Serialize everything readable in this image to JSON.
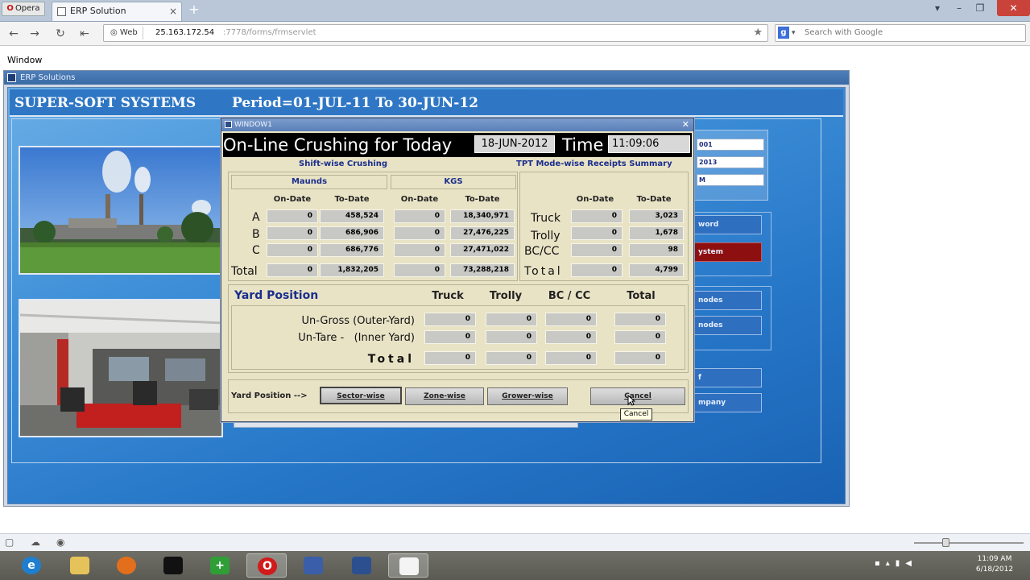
{
  "browser": {
    "menu_label": "Opera",
    "tab_title": "ERP Solution",
    "web_chip": "Web",
    "url_host": "25.163.172.54",
    "url_path": ":7778/forms/frmservlet",
    "search_placeholder": "Search with Google"
  },
  "page_menu": {
    "window": "Window"
  },
  "erp": {
    "window_title": "ERP Solutions",
    "company": "SUPER-SOFT SYSTEMS",
    "period": "Period=01-JUL-11 To 30-JUN-12",
    "right_fields": [
      "001",
      "2013",
      "M"
    ],
    "side_buttons": [
      {
        "label": "word",
        "style": "blue"
      },
      {
        "label": "ystem",
        "style": "red"
      },
      {
        "label": "nodes",
        "style": "blue"
      },
      {
        "label": "nodes",
        "style": "blue"
      },
      {
        "label": "f",
        "style": "blue"
      },
      {
        "label": "mpany",
        "style": "blue"
      }
    ]
  },
  "modal": {
    "title": "WINDOW1",
    "heading": "On-Line Crushing for Today",
    "date": "18-JUN-2012",
    "time_label": "Time",
    "time": "11:09:06",
    "shift_title": "Shift-wise Crushing",
    "tpt_title": "TPT Mode-wise Receipts Summary",
    "maunds_label": "Maunds",
    "kgs_label": "KGS",
    "on_date": "On-Date",
    "to_date": "To-Date",
    "shift_rows": [
      {
        "label": "A",
        "maunds_on": "0",
        "maunds_to": "458,524",
        "kgs_on": "0",
        "kgs_to": "18,340,971"
      },
      {
        "label": "B",
        "maunds_on": "0",
        "maunds_to": "686,906",
        "kgs_on": "0",
        "kgs_to": "27,476,225"
      },
      {
        "label": "C",
        "maunds_on": "0",
        "maunds_to": "686,776",
        "kgs_on": "0",
        "kgs_to": "27,471,022"
      },
      {
        "label": "Total",
        "maunds_on": "0",
        "maunds_to": "1,832,205",
        "kgs_on": "0",
        "kgs_to": "73,288,218"
      }
    ],
    "tpt_rows": [
      {
        "label": "Truck",
        "on": "0",
        "to": "3,023"
      },
      {
        "label": "Trolly",
        "on": "0",
        "to": "1,678"
      },
      {
        "label": "BC/CC",
        "on": "0",
        "to": "98"
      },
      {
        "label": "Total",
        "on": "0",
        "to": "4,799"
      }
    ],
    "yard": {
      "title": "Yard Position",
      "cols": [
        "Truck",
        "Trolly",
        "BC / CC",
        "Total"
      ],
      "rows": [
        {
          "label": "Un-Gross (Outer-Yard)",
          "values": [
            "0",
            "0",
            "0",
            "0"
          ]
        },
        {
          "label": "Un-Tare -   (Inner Yard)",
          "values": [
            "0",
            "0",
            "0",
            "0"
          ]
        },
        {
          "label": "Total",
          "values": [
            "0",
            "0",
            "0",
            "0"
          ]
        }
      ]
    },
    "bottom": {
      "label": "Yard Position  -->",
      "sector": "Sector-wise",
      "zone": "Zone-wise",
      "grower": "Grower-wise",
      "cancel": "Cancel",
      "tooltip": "Cancel"
    }
  },
  "taskbar": {
    "clock_time": "11:09 AM",
    "clock_date": "6/18/2012"
  }
}
